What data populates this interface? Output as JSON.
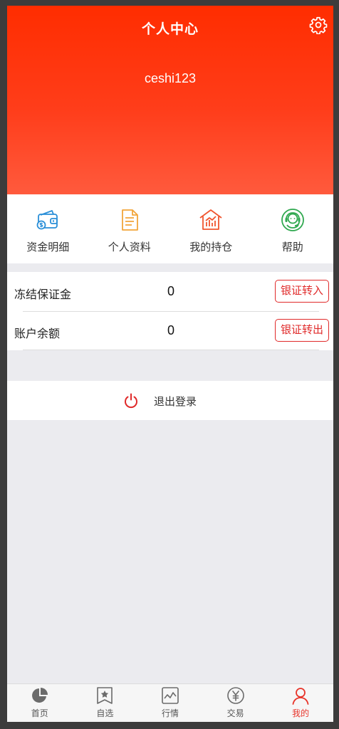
{
  "header": {
    "title": "个人中心",
    "username": "ceshi123"
  },
  "quick_menu": [
    {
      "label": "资金明细",
      "icon": "wallet-icon"
    },
    {
      "label": "个人资料",
      "icon": "document-icon"
    },
    {
      "label": "我的持仓",
      "icon": "holdings-icon"
    },
    {
      "label": "帮助",
      "icon": "help-icon"
    }
  ],
  "balance": {
    "frozen": {
      "label": "冻结保证金",
      "value": "0",
      "button": "银证转入"
    },
    "account": {
      "label": "账户余额",
      "value": "0",
      "button": "银证转出"
    }
  },
  "logout": {
    "label": "退出登录",
    "icon": "power-icon"
  },
  "tabbar": [
    {
      "label": "首页",
      "icon": "pie-chart-icon",
      "active": false
    },
    {
      "label": "自选",
      "icon": "star-bookmark-icon",
      "active": false
    },
    {
      "label": "行情",
      "icon": "line-chart-icon",
      "active": false
    },
    {
      "label": "交易",
      "icon": "yen-icon",
      "active": false
    },
    {
      "label": "我的",
      "icon": "user-icon",
      "active": true
    }
  ],
  "colors": {
    "header_top": "#ff2d00",
    "header_bottom": "#ff5a3d",
    "accent": "#e8342a",
    "button_border": "#e02a2a",
    "background": "#ebebef"
  }
}
